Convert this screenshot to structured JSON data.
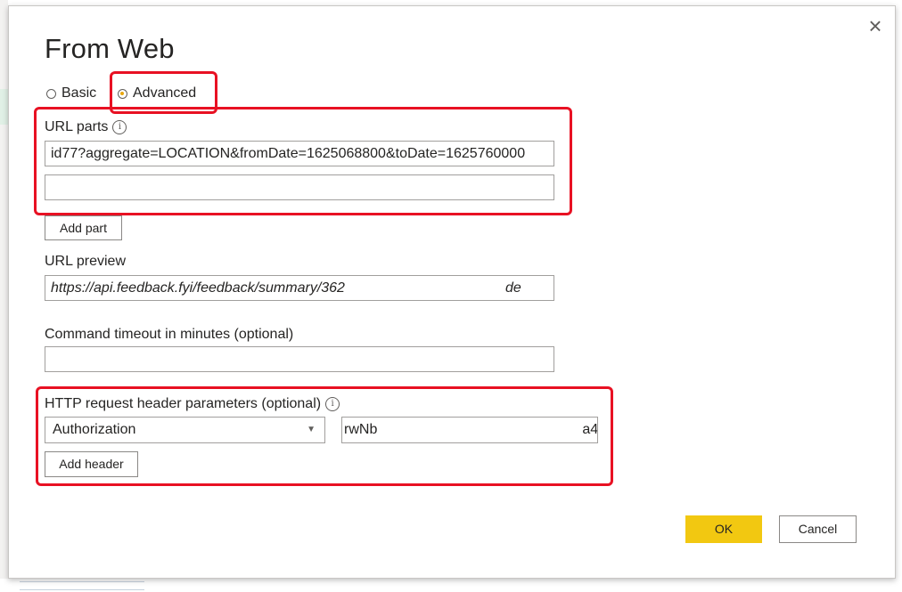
{
  "dialog": {
    "title": "From Web",
    "close_glyph": "×"
  },
  "mode": {
    "options": [
      {
        "label": "Basic",
        "selected": false
      },
      {
        "label": "Advanced",
        "selected": true
      }
    ]
  },
  "url_parts": {
    "label": "URL parts",
    "parts": [
      "id77?aggregate=LOCATION&fromDate=1625068800&toDate=1625760000",
      ""
    ],
    "add_button": "Add part"
  },
  "url_preview": {
    "label": "URL preview",
    "value_visible": "https://api.feedback.fyi/feedback/summary/362",
    "value_tail": "de"
  },
  "timeout": {
    "label": "Command timeout in minutes (optional)",
    "value": ""
  },
  "headers": {
    "label": "HTTP request header parameters (optional)",
    "selected_header": "Authorization",
    "value_start": "rwNb",
    "value_end": "a4",
    "add_button": "Add header"
  },
  "footer": {
    "ok_label": "OK",
    "cancel_label": "Cancel"
  },
  "colors": {
    "accent": "#f2c811",
    "highlight": "#e81123",
    "radio_selected": "#e8a70e"
  },
  "icons": {
    "info": "info-icon",
    "close": "close-icon",
    "dropdown": "chevron-down-icon"
  }
}
